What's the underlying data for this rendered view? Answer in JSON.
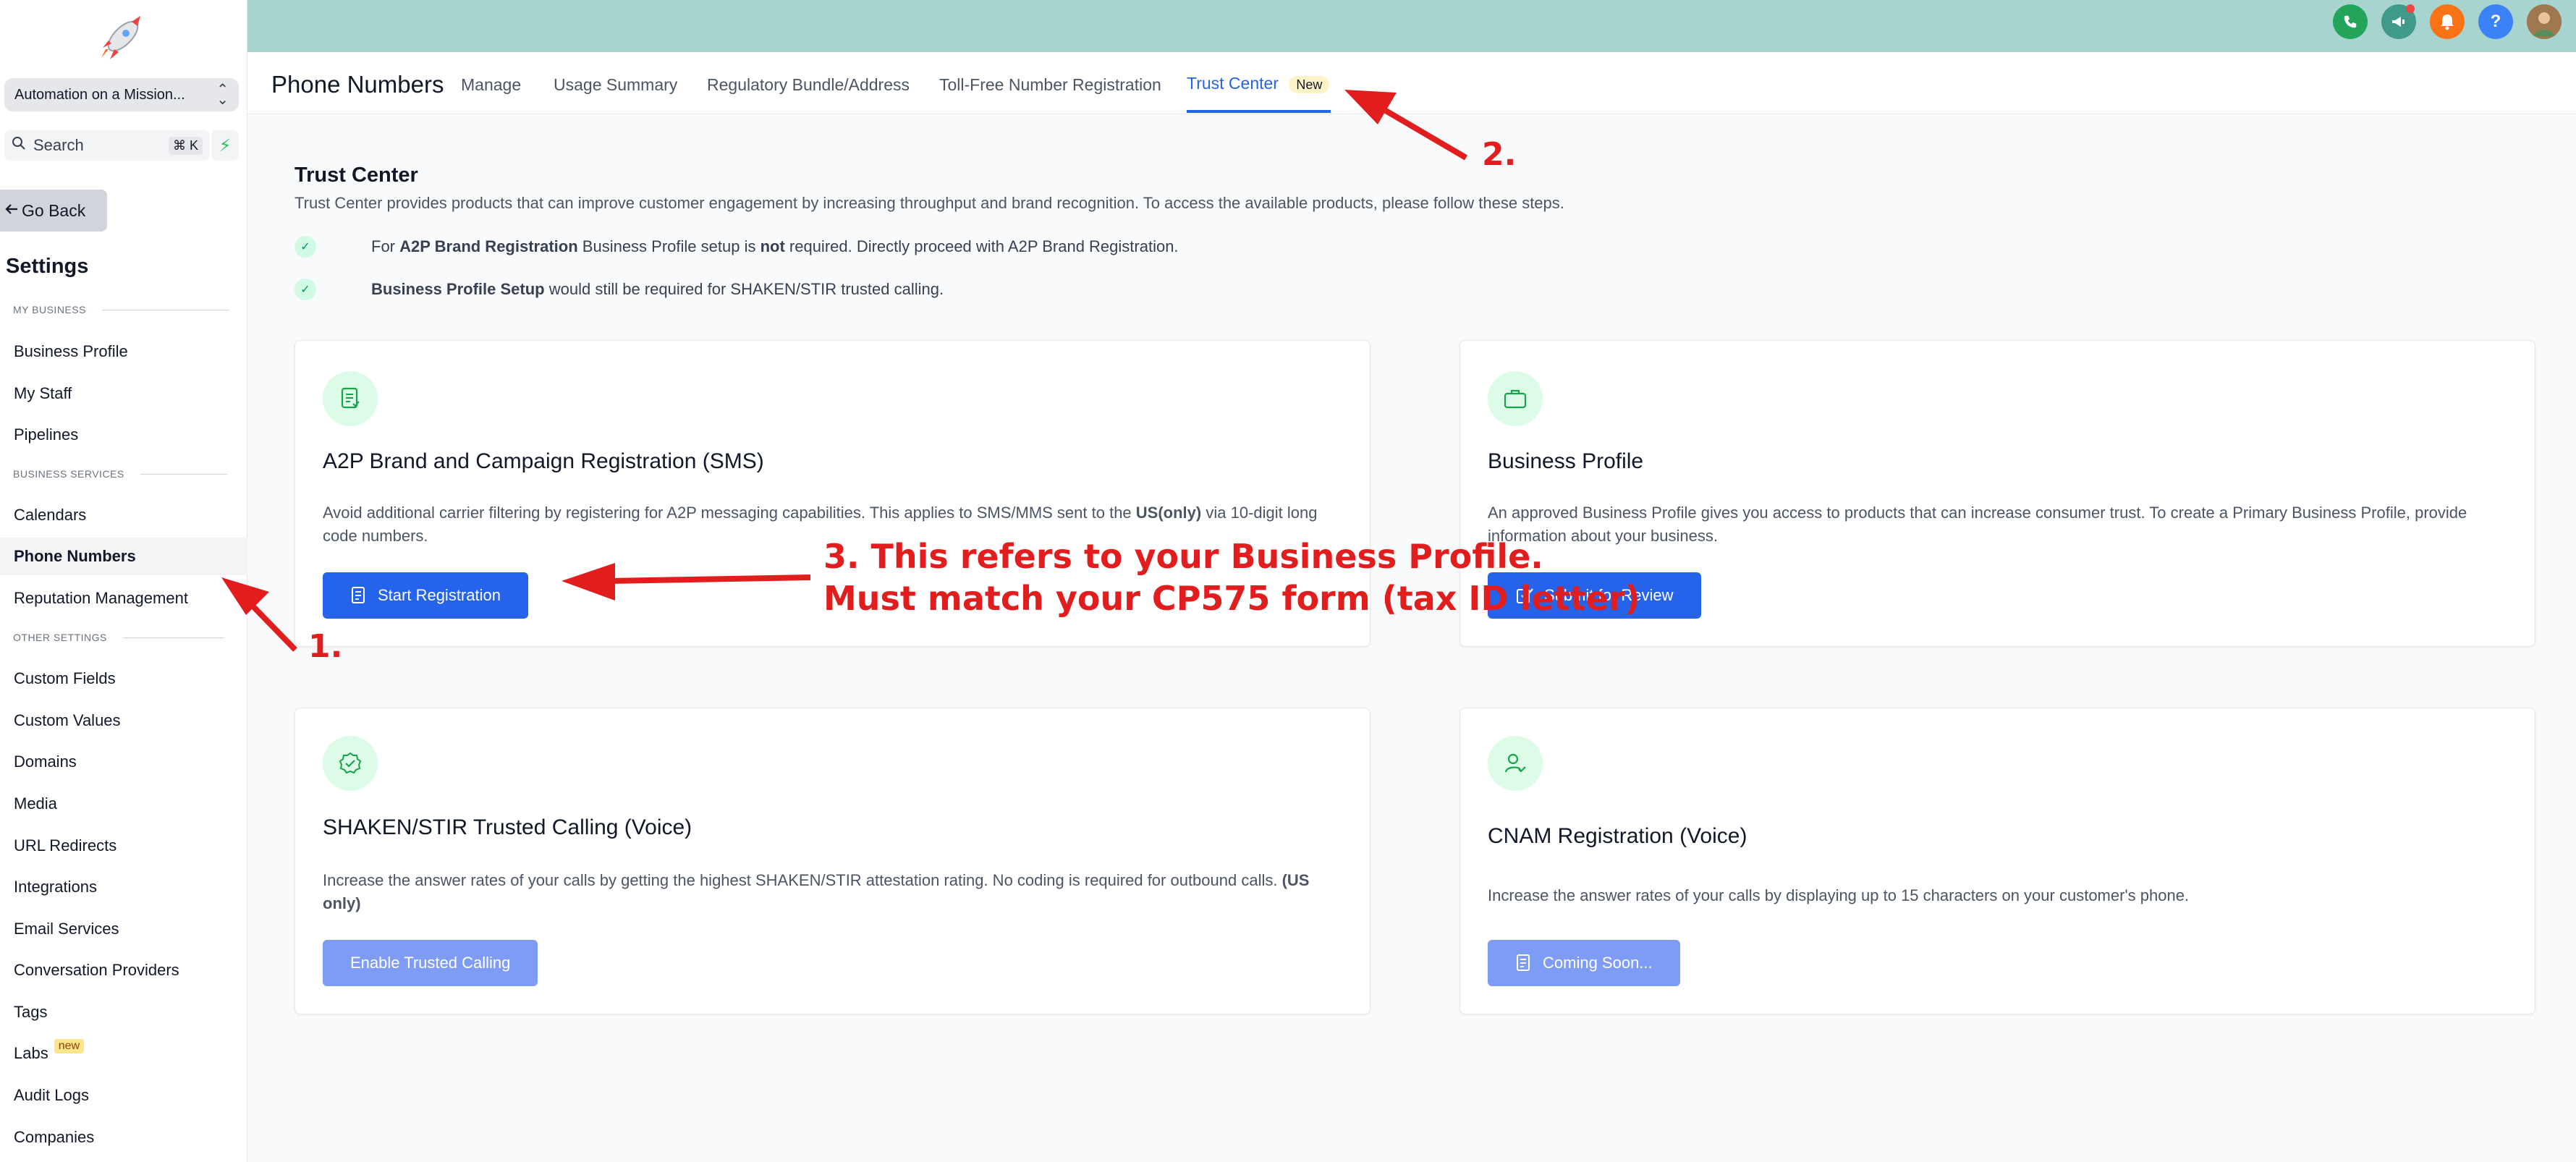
{
  "sidebar": {
    "account": "Automation on a Mission...",
    "search_placeholder": "Search",
    "search_shortcut": "⌘ K",
    "go_back": "Go Back",
    "settings_title": "Settings",
    "sections": {
      "my_business": "MY BUSINESS",
      "business_services": "BUSINESS SERVICES",
      "other_settings": "OTHER SETTINGS"
    },
    "items": [
      "Business Profile",
      "My Staff",
      "Pipelines",
      "Calendars",
      "Phone Numbers",
      "Reputation Management",
      "Custom Fields",
      "Custom Values",
      "Domains",
      "Media",
      "URL Redirects",
      "Integrations",
      "Email Services",
      "Conversation Providers",
      "Tags",
      "Labs",
      "Audit Logs",
      "Companies"
    ],
    "labs_badge": "new",
    "active_item": "Phone Numbers"
  },
  "header": {
    "page_title": "Phone Numbers",
    "tabs": [
      "Manage",
      "Usage Summary",
      "Regulatory Bundle/Address",
      "Toll-Free Number Registration",
      "Trust Center"
    ],
    "active_tab": "Trust Center",
    "trust_center_badge": "New"
  },
  "main": {
    "title": "Trust Center",
    "description": "Trust Center provides products that can improve customer engagement by increasing throughput and brand recognition. To access the available products, please follow these steps.",
    "check1": {
      "p1": "For ",
      "b1": "A2P Brand Registration",
      "p2": " Business Profile setup is ",
      "b2": "not",
      "p3": " required. Directly proceed with A2P Brand Registration."
    },
    "check2": {
      "b1": "Business Profile Setup",
      "p1": " would still be required for SHAKEN/STIR trusted calling."
    },
    "cards": [
      {
        "title": "A2P Brand and Campaign Registration (SMS)",
        "desc_p1": "Avoid additional carrier filtering by registering for A2P messaging capabilities. This applies to SMS/MMS sent to the ",
        "desc_b": "US(only)",
        "desc_p2": " via 10-digit long code numbers.",
        "button": "Start Registration",
        "icon": "document-icon"
      },
      {
        "title": "Business Profile",
        "desc": "An approved Business Profile gives you access to products that can increase consumer trust. To create a Primary Business Profile, provide information about your business.",
        "button": "Submit for Review",
        "icon": "briefcase-icon"
      },
      {
        "title": "SHAKEN/STIR Trusted Calling (Voice)",
        "desc_p1": "Increase the answer rates of your calls by getting the highest SHAKEN/STIR attestation rating. No coding is required for outbound calls. ",
        "desc_b": "(US only)",
        "button": "Enable Trusted Calling",
        "icon": "badge-check-icon"
      },
      {
        "title": "CNAM Registration (Voice)",
        "desc": "Increase the answer rates of your calls by displaying up to 15 characters on your customer's phone.",
        "button": "Coming Soon...",
        "icon": "user-check-icon"
      }
    ]
  },
  "annotations": {
    "a1": "1.",
    "a2": "2.",
    "a3_line1": "3. This refers to your Business Profile.",
    "a3_line2": "Must match your CP575 form (tax ID letter)"
  },
  "colors": {
    "primary": "#2563eb",
    "topbar": "#a8d4cf",
    "annotation": "#e11d1d"
  }
}
